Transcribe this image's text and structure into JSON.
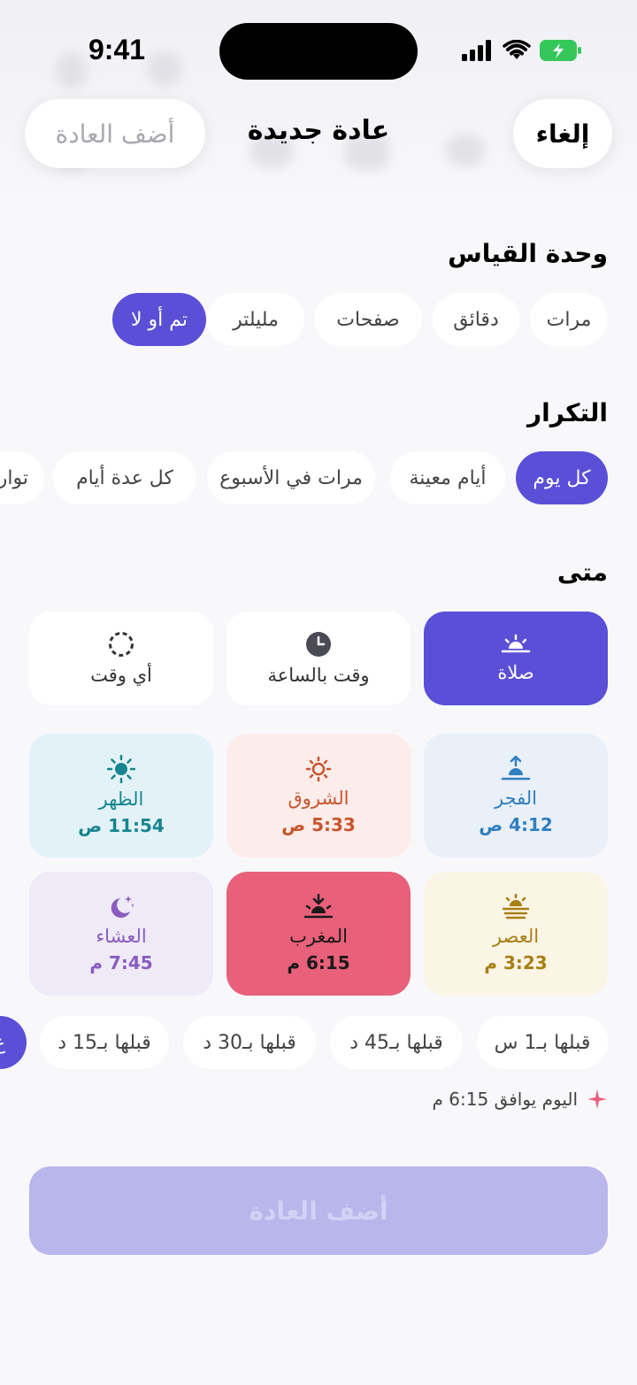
{
  "status": {
    "time": "9:41"
  },
  "header": {
    "cancel": "إلغاء",
    "title": "عادة جديدة",
    "add": "أضف العادة"
  },
  "unit": {
    "title": "وحدة القياس",
    "options": [
      "مرات",
      "دقائق",
      "صفحات",
      "مليلتر",
      "تم أو لا"
    ],
    "selected": "تم أو لا"
  },
  "repeat": {
    "title": "التكرار",
    "options": [
      "كل يوم",
      "أيام معينة",
      "مرات في الأسبوع",
      "كل عدة أيام",
      "توار"
    ],
    "selected": "كل يوم"
  },
  "when": {
    "title": "متى",
    "modes": [
      "صلاة",
      "وقت بالساعة",
      "أي وقت"
    ],
    "selected": "صلاة"
  },
  "prayers": [
    {
      "name": "الفجر",
      "time": "4:12 ص",
      "color": "#2f7fc0",
      "bg": "#eaf0f8"
    },
    {
      "name": "الشروق",
      "time": "5:33 ص",
      "color": "#c8552e",
      "bg": "#fcecea"
    },
    {
      "name": "الظهر",
      "time": "11:54 ص",
      "color": "#17858f",
      "bg": "#e3f2f7"
    },
    {
      "name": "العصر",
      "time": "3:23 م",
      "color": "#a87f14",
      "bg": "#fbf5e6"
    },
    {
      "name": "المغرب",
      "time": "6:15 م",
      "color": "#1a1a1a",
      "bg": "#e8607a",
      "selected": true
    },
    {
      "name": "العشاء",
      "time": "7:45 م",
      "color": "#8a5cc0",
      "bg": "#eeeaf6"
    }
  ],
  "offsets": [
    "قبلها بـ1 س",
    "قبلها بـ45 د",
    "قبلها بـ30 د",
    "قبلها بـ15 د",
    "ع"
  ],
  "note": "اليوم يوافق 6:15 م",
  "submit": "أضف العادة",
  "colors": {
    "accent": "#5a4fd6",
    "submit_disabled": "#b9b6ec"
  }
}
